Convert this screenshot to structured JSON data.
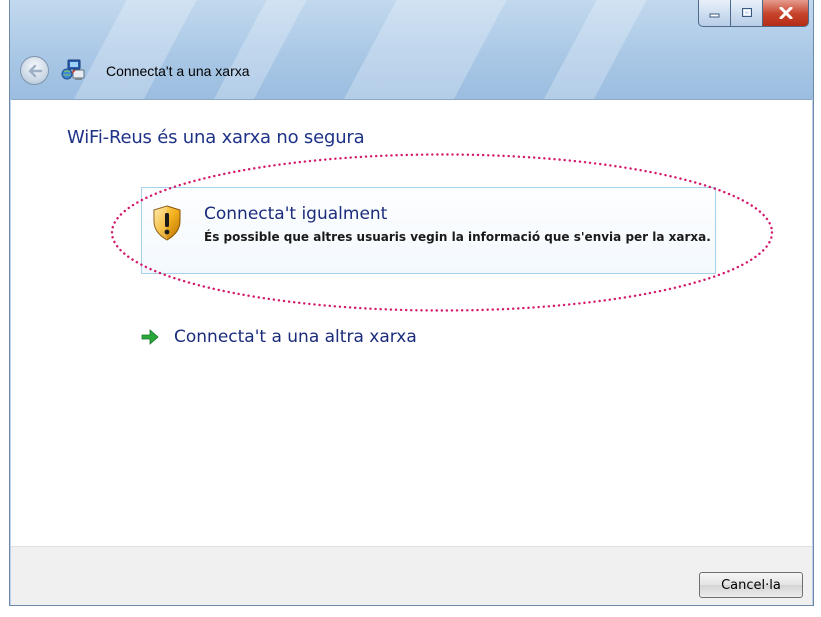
{
  "window": {
    "title": "Connecta't a una xarxa",
    "caption_buttons": [
      "minimize-icon",
      "maximize-icon",
      "close-icon"
    ]
  },
  "main": {
    "heading": "WiFi-Reus és una xarxa no segura",
    "option": {
      "icon": "security-shield-icon",
      "title": "Connecta't igualment",
      "description": "És possible que altres usuaris vegin la informació que s'envia per la xarxa."
    },
    "alt_link": {
      "icon": "green-arrow-icon",
      "label": "Connecta't a una altra xarxa"
    }
  },
  "footer": {
    "cancel_label": "Cancel·la"
  },
  "colors": {
    "heading": "#1e3287",
    "link": "#1b2c7b",
    "annotation_dots": "#d4186c",
    "option_border": "#a6d1ea",
    "close_button": "#c6432c"
  }
}
